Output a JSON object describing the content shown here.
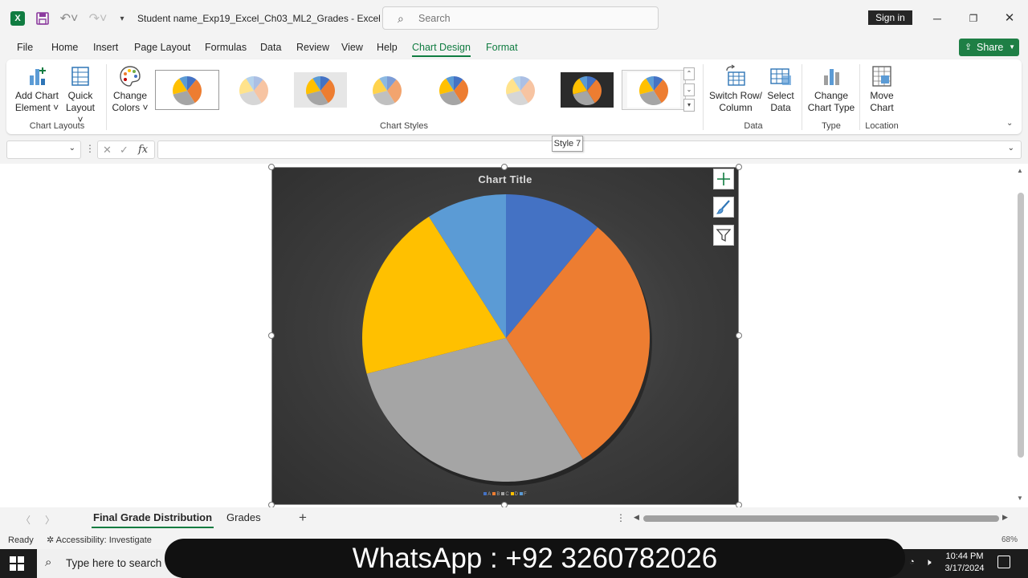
{
  "app": {
    "doc_title": "Student name_Exp19_Excel_Ch03_ML2_Grades  -  Excel",
    "search_placeholder": "Search",
    "signin_label": "Sign in"
  },
  "ribbon_tabs": [
    "File",
    "Home",
    "Insert",
    "Page Layout",
    "Formulas",
    "Data",
    "Review",
    "View",
    "Help",
    "Chart Design",
    "Format"
  ],
  "active_tab": "Chart Design",
  "share_label": "Share",
  "ribbon": {
    "add_chart_element": [
      "Add Chart",
      "Element ˅"
    ],
    "quick_layout": [
      "Quick",
      "Layout ˅"
    ],
    "change_colors": [
      "Change",
      "Colors ˅"
    ],
    "switch_row_column": [
      "Switch Row/",
      "Column"
    ],
    "select_data": [
      "Select",
      "Data"
    ],
    "change_chart_type": [
      "Change",
      "Chart Type"
    ],
    "move_chart": [
      "Move",
      "Chart"
    ],
    "groups": {
      "chart_layouts": "Chart Layouts",
      "chart_styles": "Chart Styles",
      "data": "Data",
      "type": "Type",
      "location": "Location"
    },
    "tooltip": "Style 7"
  },
  "formula_bar": {
    "name_box": "",
    "formula": ""
  },
  "chart_data": {
    "type": "pie",
    "title": "Chart Title",
    "categories": [
      "A",
      "B",
      "C",
      "D",
      "F"
    ],
    "values": [
      11,
      30,
      30,
      20,
      9
    ],
    "colors": [
      "#4472c4",
      "#ed7d31",
      "#a5a5a5",
      "#ffc000",
      "#5b9bd5"
    ],
    "legend_position": "bottom"
  },
  "sheet_tabs": [
    "Final Grade Distribution",
    "Grades"
  ],
  "active_sheet": "Final Grade Distribution",
  "status": {
    "ready": "Ready",
    "accessibility": "Accessibility: Investigate",
    "zoom": "68%"
  },
  "taskbar": {
    "search_placeholder": "Type here to search",
    "banner": "WhatsApp : +92 3260782026",
    "time": "10:44 PM",
    "date": "3/17/2024"
  }
}
